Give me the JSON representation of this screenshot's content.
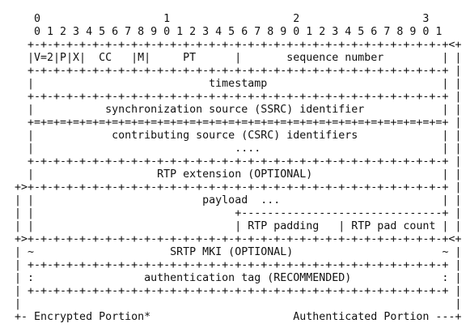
{
  "diagram": {
    "lines": [
      "    0                   1                   2                   3",
      "    0 1 2 3 4 5 6 7 8 9 0 1 2 3 4 5 6 7 8 9 0 1 2 3 4 5 6 7 8 9 0 1",
      "   +-+-+-+-+-+-+-+-+-+-+-+-+-+-+-+-+-+-+-+-+-+-+-+-+-+-+-+-+-+-+-+-+<+",
      "   |V=2|P|X|  CC   |M|     PT      |       sequence number         | |",
      "   +-+-+-+-+-+-+-+-+-+-+-+-+-+-+-+-+-+-+-+-+-+-+-+-+-+-+-+-+-+-+-+-+ |",
      "   |                           timestamp                           | |",
      "   +-+-+-+-+-+-+-+-+-+-+-+-+-+-+-+-+-+-+-+-+-+-+-+-+-+-+-+-+-+-+-+-+ |",
      "   |           synchronization source (SSRC) identifier            | |",
      "   +=+=+=+=+=+=+=+=+=+=+=+=+=+=+=+=+=+=+=+=+=+=+=+=+=+=+=+=+=+=+=+=+ |",
      "   |            contributing source (CSRC) identifiers             | |",
      "   |                               ....                            | |",
      "   +-+-+-+-+-+-+-+-+-+-+-+-+-+-+-+-+-+-+-+-+-+-+-+-+-+-+-+-+-+-+-+-+ |",
      "   |                   RTP extension (OPTIONAL)                    | |",
      " +>+-+-+-+-+-+-+-+-+-+-+-+-+-+-+-+-+-+-+-+-+-+-+-+-+-+-+-+-+-+-+-+-+ |",
      " | |                          payload  ...                         | |",
      " | |                               +-------------------------------+ |",
      " | |                               | RTP padding   | RTP pad count | |",
      " +>+-+-+-+-+-+-+-+-+-+-+-+-+-+-+-+-+-+-+-+-+-+-+-+-+-+-+-+-+-+-+-+-+<+",
      " | ~                     SRTP MKI (OPTIONAL)                       ~ |",
      " | +-+-+-+-+-+-+-+-+-+-+-+-+-+-+-+-+-+-+-+-+-+-+-+-+-+-+-+-+-+-+-+-+ |",
      " | :                 authentication tag (RECOMMENDED)              : |",
      " | +-+-+-+-+-+-+-+-+-+-+-+-+-+-+-+-+-+-+-+-+-+-+-+-+-+-+-+-+-+-+-+-+ |",
      " |                                                                   |",
      " +- Encrypted Portion*                      Authenticated Portion ---+"
    ]
  }
}
